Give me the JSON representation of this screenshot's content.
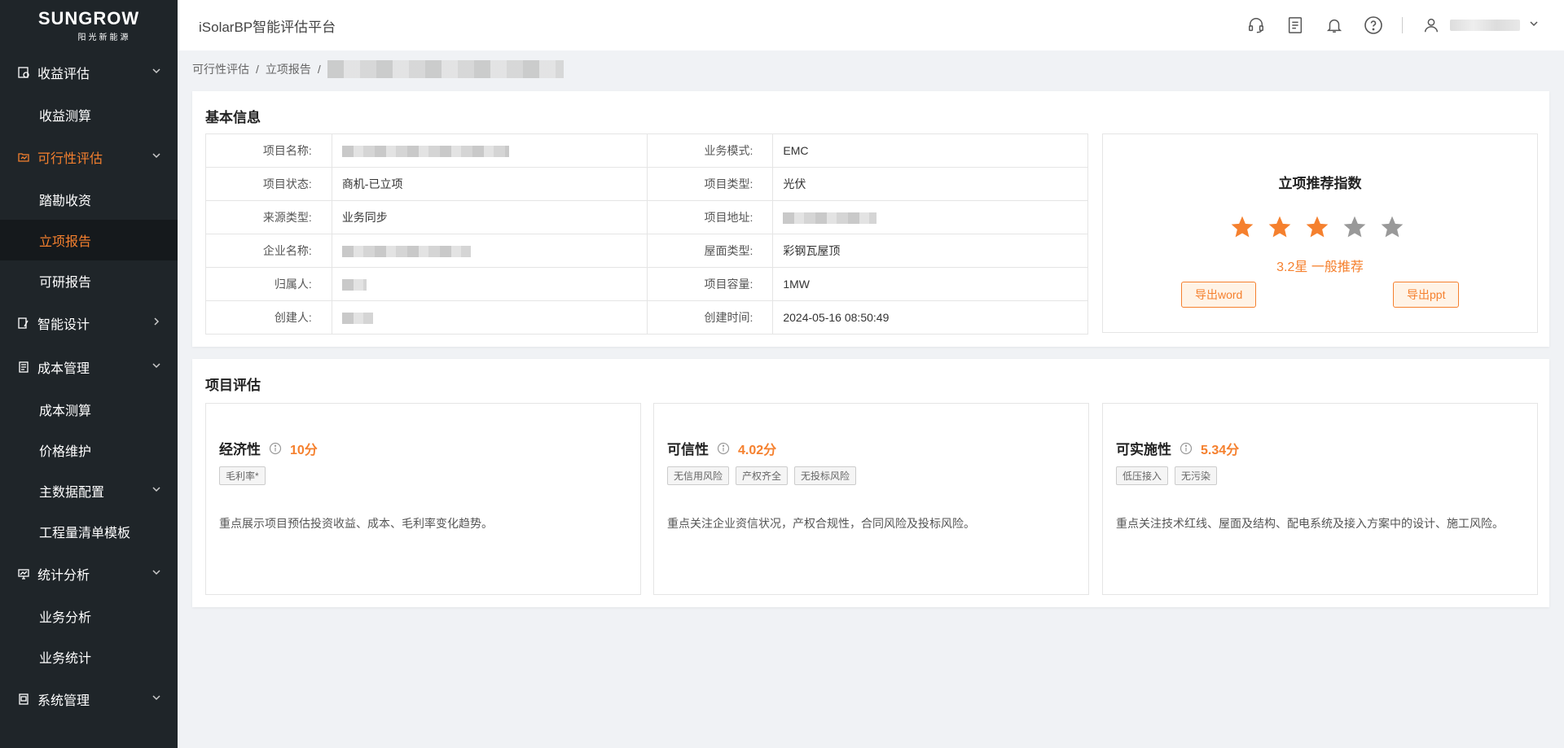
{
  "logo": {
    "brand": "SUNGROW",
    "sub": "阳光新能源"
  },
  "app_title": "iSolarBP智能评估平台",
  "sidebar": {
    "groups": [
      {
        "label": "收益评估",
        "icon": "calculator-icon",
        "expanded": true,
        "children": [
          {
            "label": "收益测算"
          }
        ]
      },
      {
        "label": "可行性评估",
        "icon": "folder-icon",
        "expanded": true,
        "active": true,
        "children": [
          {
            "label": "踏勘收资"
          },
          {
            "label": "立项报告",
            "active": true
          },
          {
            "label": "可研报告"
          }
        ]
      },
      {
        "label": "智能设计",
        "icon": "design-icon",
        "expanded": false,
        "children": []
      },
      {
        "label": "成本管理",
        "icon": "ledger-icon",
        "expanded": true,
        "children": [
          {
            "label": "成本测算"
          },
          {
            "label": "价格维护"
          },
          {
            "label": "主数据配置",
            "has_children": true
          },
          {
            "label": "工程量清单模板"
          }
        ]
      },
      {
        "label": "统计分析",
        "icon": "monitor-icon",
        "expanded": true,
        "children": [
          {
            "label": "业务分析"
          },
          {
            "label": "业务统计"
          }
        ]
      },
      {
        "label": "系统管理",
        "icon": "settings-box-icon",
        "expanded": true,
        "children": []
      }
    ]
  },
  "breadcrumb": {
    "items": [
      "可行性评估",
      "立项报告"
    ],
    "separator": "/"
  },
  "basic_info": {
    "title": "基本信息",
    "rows": [
      {
        "l1": "项目名称:",
        "v1": "",
        "l2": "业务模式:",
        "v2": "EMC"
      },
      {
        "l1": "项目状态:",
        "v1": "商机-已立项",
        "l2": "项目类型:",
        "v2": "光伏"
      },
      {
        "l1": "来源类型:",
        "v1": "业务同步",
        "l2": "项目地址:",
        "v2": ""
      },
      {
        "l1": "企业名称:",
        "v1": "",
        "l2": "屋面类型:",
        "v2": "彩钢瓦屋顶"
      },
      {
        "l1": "归属人:",
        "v1": "",
        "l2": "项目容量:",
        "v2": "1MW"
      },
      {
        "l1": "创建人:",
        "v1": "",
        "l2": "创建时间:",
        "v2": "2024-05-16 08:50:49"
      }
    ]
  },
  "recommendation": {
    "title": "立项推荐指数",
    "stars_filled": 3,
    "stars_total": 5,
    "text": "3.2星 一般推荐",
    "export_word": "导出word",
    "export_ppt": "导出ppt"
  },
  "evaluation": {
    "title": "项目评估",
    "cards": [
      {
        "name": "经济性",
        "score": "10分",
        "tags": [
          "毛利率*"
        ],
        "desc": "重点展示项目预估投资收益、成本、毛利率变化趋势。"
      },
      {
        "name": "可信性",
        "score": "4.02分",
        "tags": [
          "无信用风险",
          "产权齐全",
          "无投标风险"
        ],
        "desc": "重点关注企业资信状况，产权合规性，合同风险及投标风险。"
      },
      {
        "name": "可实施性",
        "score": "5.34分",
        "tags": [
          "低压接入",
          "无污染"
        ],
        "desc": "重点关注技术红线、屋面及结构、配电系统及接入方案中的设计、施工风险。"
      }
    ]
  },
  "colors": {
    "accent": "#f5802e",
    "sidebar_bg": "#1f2529",
    "star_off": "#999999"
  }
}
